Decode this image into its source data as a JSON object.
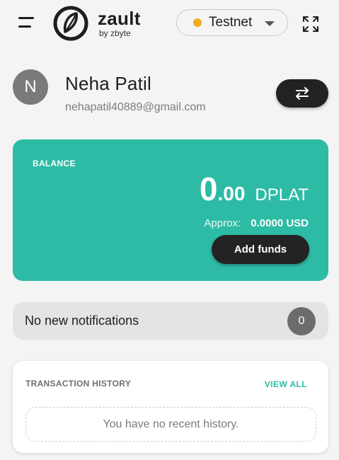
{
  "header": {
    "brand_name": "zault",
    "brand_sub": "by zbyte",
    "network": {
      "label": "Testnet",
      "dot_color": "#f2ac1c"
    }
  },
  "profile": {
    "initial": "N",
    "name": "Neha Patil",
    "email": "nehapatil40889@gmail.com"
  },
  "balance": {
    "label": "BALANCE",
    "amount_int": "0",
    "amount_dec": ".00",
    "unit": "DPLAT",
    "approx_label": "Approx:",
    "approx_value": "0.0000 USD",
    "add_funds_label": "Add funds",
    "card_color": "#2dbba6"
  },
  "notifications": {
    "text": "No new notifications",
    "count": "0"
  },
  "history": {
    "title": "TRANSACTION HISTORY",
    "view_all_label": "VIEW ALL",
    "empty_text": "You have no recent history."
  },
  "icons": {
    "menu": "menu-icon",
    "logo": "zault-logo-icon",
    "expand": "expand-icon",
    "switch": "swap-arrows-icon",
    "caret": "chevron-down-icon"
  }
}
